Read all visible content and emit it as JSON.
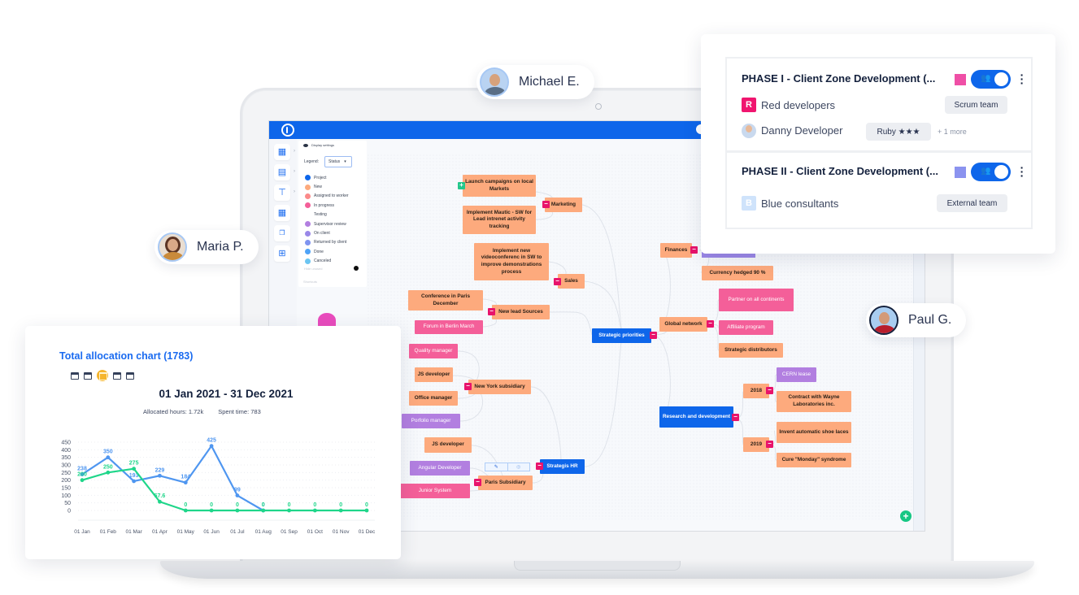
{
  "users": {
    "michael": "Michael E.",
    "maria": "Maria P.",
    "paul": "Paul G."
  },
  "app": {
    "display_settings": "Display settings",
    "legend_label": "Legend:",
    "legend_select": "Status",
    "legend_items": [
      {
        "label": "Project",
        "color": "#0e66ea"
      },
      {
        "label": "New",
        "color": "#fdaa7d"
      },
      {
        "label": "Assigned to worker",
        "color": "#fb8a8a"
      },
      {
        "label": "In progress",
        "color": "#f45f99"
      },
      {
        "label": "Testing",
        "color": ""
      },
      {
        "label": "Supervisor review",
        "color": "#b27fe0"
      },
      {
        "label": "On client",
        "color": "#9a88e8"
      },
      {
        "label": "Returned by client",
        "color": "#7f94f0"
      },
      {
        "label": "Done",
        "color": "#4fa3f7"
      },
      {
        "label": "Canceled",
        "color": "#6cc5f2"
      }
    ],
    "hide_unused": "Hide unused",
    "shortcuts": "Shortcuts",
    "sidebar_icons": [
      "dashboard-icon",
      "clipboard-icon",
      "hierarchy-icon",
      "grid-icon",
      "copy-icon",
      "add-square-icon"
    ]
  },
  "mindmap": {
    "nodes": {
      "launch_campaigns": "Launch campaigns on local Markets",
      "implement_mautic": "Implement Mautic - SW for Lead intrenet activity tracking",
      "marketing": "Marketing",
      "implement_videoconf": "Implement new videoconferenc in SW to improve demonstrations process",
      "sales": "Sales",
      "conference_paris": "Conference in Paris December",
      "new_lead_sources": "New lead Sources",
      "forum_berlin": "Forum in Berlin March",
      "quality_manager": "Quality manager",
      "js_developer_ny": "JS developer",
      "office_manager": "Office manager",
      "portfolio_manager": "Porfolio manager",
      "new_york_subsidiary": "New York subsidiary",
      "js_developer_paris": "JS developer",
      "angular_developer": "Angular Developer",
      "junior_system": "Junior System",
      "paris_subsidiary": "Paris Subsidiary",
      "strategis_hr": "Strategis HR",
      "strategic_priorities": "Strategic priorities",
      "finances": "Finances",
      "currency_hedged": "Currency hedged 90 %",
      "global_network": "Global network",
      "partner_all_continents": "Partner on all continents",
      "affiliate_program": "Affiliate program",
      "strategic_distributors": "Strategic distributors",
      "research_development": "Research and development",
      "y2018": "2018",
      "cern_lease": "CERN lease",
      "contract_wayne": "Contract with Wayne Laboratories inc.",
      "y2019": "2019",
      "shoe_laces": "Invent automatic shoe laces",
      "cure_monday": "Cure \"Monday\" syndrome"
    },
    "tools": {
      "edit": "✎",
      "settings": "◎"
    }
  },
  "phases": [
    {
      "title": "PHASE I - Client Zone Development (...",
      "color": "#ef4fa6",
      "toggle_on": true,
      "team_initial": "R",
      "team_color": "#f0156f",
      "team_name": "Red developers",
      "team_type": "Scrum team",
      "person": "Danny Developer",
      "skill": "Ruby ★★★",
      "more": "+ 1 more"
    },
    {
      "title": "PHASE II - Client Zone Development (...",
      "color": "#8b93ef",
      "toggle_on": true,
      "team_initial": "B",
      "team_color": "#cfe3fb",
      "team_name": "Blue consultants",
      "team_type": "External team"
    }
  ],
  "allocation": {
    "title": "Total allocation chart (1783)",
    "range": "01 Jan 2021 - 31 Dec 2021",
    "allocated": "Allocated hours: 1.72k",
    "spent": "Spent time: 783",
    "period_icons": [
      "calendar-day-icon",
      "calendar-week-icon",
      "calendar-month-icon",
      "calendar-quarter-icon",
      "calendar-year-icon"
    ]
  },
  "chart_data": {
    "type": "line",
    "title": "Total allocation chart (1783)",
    "categories": [
      "01 Jan",
      "01 Feb",
      "01 Mar",
      "01 Apr",
      "01 May",
      "01 Jun",
      "01 Jul",
      "01 Aug",
      "01 Sep",
      "01 Oct",
      "01 Nov",
      "01 Dec"
    ],
    "series": [
      {
        "name": "Allocated hours",
        "color": "#4f96f0",
        "values": [
          238,
          350,
          193,
          229,
          184,
          425,
          99,
          0,
          null,
          null,
          null,
          null
        ]
      },
      {
        "name": "Spent time",
        "color": "#1fd68a",
        "values": [
          200,
          250,
          275,
          57.6,
          0,
          0,
          0,
          0,
          0,
          0,
          0,
          0
        ]
      }
    ],
    "yticks": [
      0,
      50,
      100,
      150,
      200,
      250,
      300,
      350,
      400,
      450
    ],
    "ylim": [
      0,
      450
    ],
    "grid": true,
    "xlabel": "",
    "ylabel": ""
  }
}
